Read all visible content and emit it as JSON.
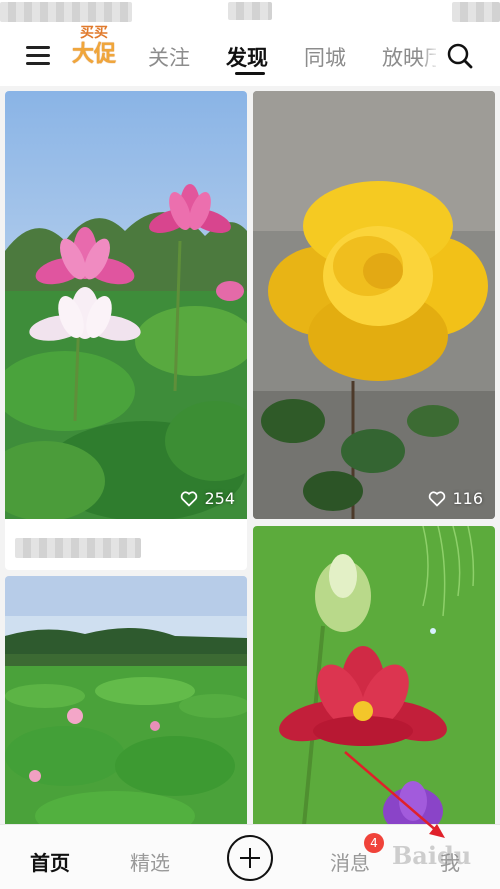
{
  "header": {
    "logo_text_top": "买买",
    "logo_text_main": "大促",
    "tabs": [
      {
        "label": "关注",
        "active": false
      },
      {
        "label": "发现",
        "active": true
      },
      {
        "label": "同城",
        "active": false
      },
      {
        "label": "放映厅",
        "active": false
      }
    ]
  },
  "feed": {
    "cards": [
      {
        "subject": "pink lotus flowers",
        "likes": "254"
      },
      {
        "subject": "yellow rose",
        "likes": "116"
      },
      {
        "subject": "lotus pond landscape"
      },
      {
        "subject": "red lotus on green background"
      }
    ]
  },
  "bottom_nav": {
    "items": [
      {
        "label": "首页",
        "active": true
      },
      {
        "label": "精选",
        "active": false
      },
      {
        "label": "消息",
        "active": false,
        "badge": "4"
      },
      {
        "label": "我",
        "active": false
      }
    ],
    "watermark": "Baidu"
  },
  "icons": [
    "menu-icon",
    "search-icon",
    "heart-icon",
    "add-icon"
  ],
  "colors": {
    "accent_text": "#111111",
    "inactive_text": "#8c8c8c",
    "badge": "#f0433a",
    "logo": "#f0a63a"
  }
}
